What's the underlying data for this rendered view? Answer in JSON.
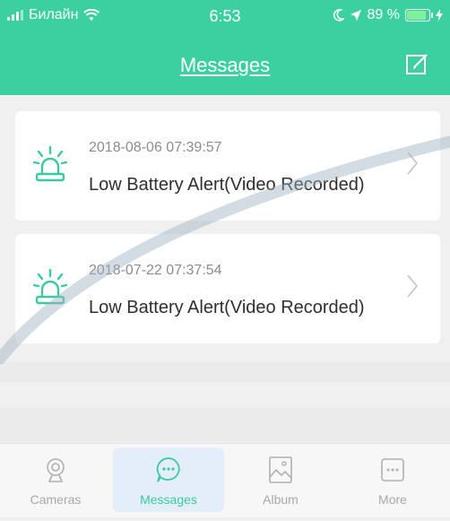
{
  "status": {
    "carrier": "Билайн",
    "time": "6:53",
    "battery": "89 %"
  },
  "header": {
    "title": "Messages"
  },
  "messages": [
    {
      "timestamp": "2018-08-06 07:39:57",
      "text": "Low Battery Alert(Video Recorded)"
    },
    {
      "timestamp": "2018-07-22 07:37:54",
      "text": "Low Battery Alert(Video Recorded)"
    }
  ],
  "tabs": [
    {
      "label": "Cameras",
      "icon": "camera-icon"
    },
    {
      "label": "Messages",
      "icon": "chat-bubble-icon"
    },
    {
      "label": "Album",
      "icon": "image-icon"
    },
    {
      "label": "More",
      "icon": "more-dots-icon"
    }
  ],
  "colors": {
    "accent": "#3cd0a0",
    "icon_green": "#3cc9a0",
    "background": "#f0f0f0"
  }
}
